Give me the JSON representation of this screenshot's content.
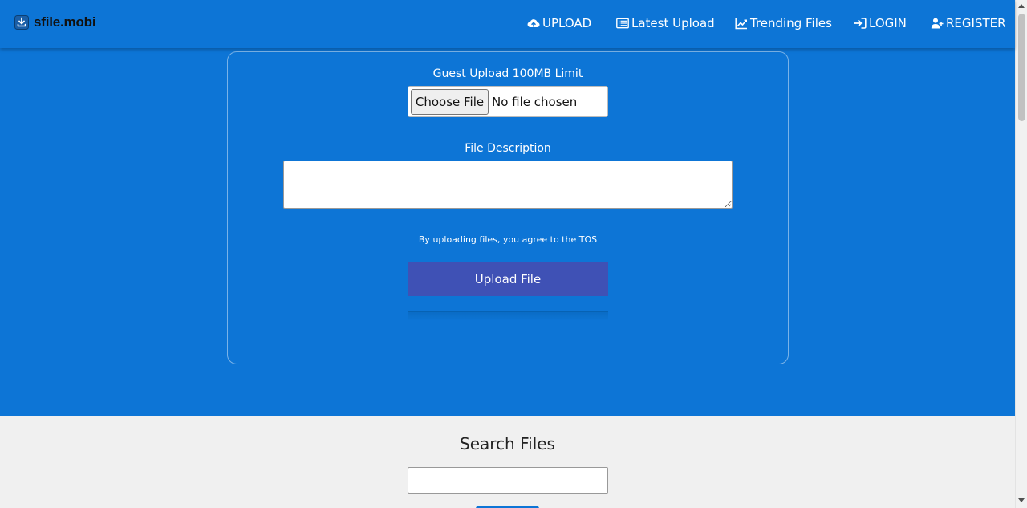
{
  "brand": {
    "name": "sfile.mobi",
    "icon": "download-icon"
  },
  "nav": [
    {
      "label": "UPLOAD",
      "icon": "cloud-upload-icon"
    },
    {
      "label": "Latest Upload",
      "icon": "list-icon"
    },
    {
      "label": "Trending Files",
      "icon": "chart-line-icon"
    },
    {
      "label": "LOGIN",
      "icon": "sign-in-icon"
    },
    {
      "label": "REGISTER",
      "icon": "user-plus-icon"
    }
  ],
  "upload_form": {
    "limit_label": "Guest Upload 100MB Limit",
    "choose_file_label": "Choose File",
    "no_file_text": "No file chosen",
    "description_label": "File Description",
    "description_value": "",
    "tos_text": "By uploading files, you agree to the TOS",
    "upload_button_label": "Upload File"
  },
  "search": {
    "title": "Search Files",
    "input_value": ""
  },
  "colors": {
    "primary": "#0d75d6",
    "upload_button": "#3f51b5",
    "page_background": "#f0f0f0"
  }
}
